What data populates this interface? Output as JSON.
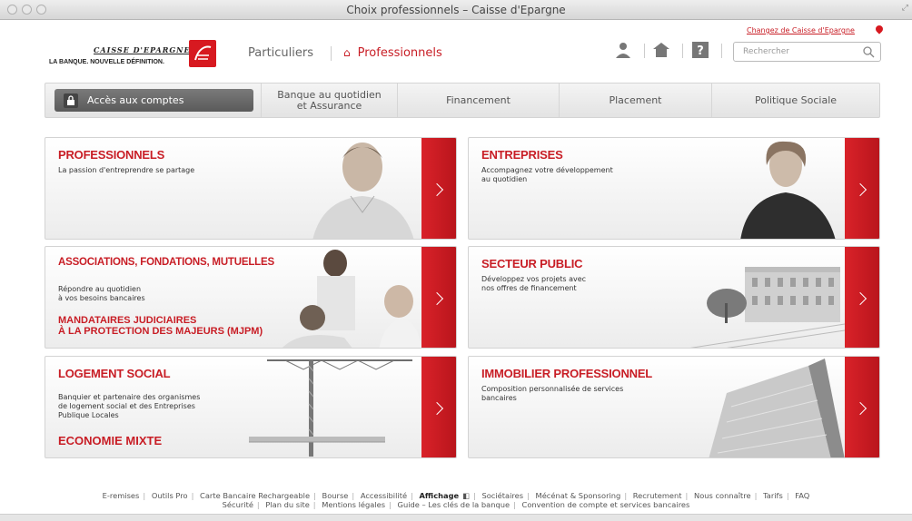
{
  "window": {
    "title": "Choix professionnels – Caisse d'Epargne"
  },
  "logo": {
    "name": "CAISSE D'EPARGNE",
    "tagline": "LA BANQUE. NOUVELLE DÉFINITION."
  },
  "nav": {
    "particuliers": "Particuliers",
    "professionnels": "Professionnels"
  },
  "header": {
    "change_link": "Changez de Caisse d'Epargne"
  },
  "search": {
    "placeholder": "Rechercher"
  },
  "menu": {
    "acces": "Accès aux comptes",
    "items": [
      "Banque au quotidien\net Assurance",
      "Financement",
      "Placement",
      "Politique Sociale"
    ]
  },
  "cards": [
    {
      "title": "PROFESSIONNELS",
      "sub": "La passion d'entreprendre se partage"
    },
    {
      "title": "ENTREPRISES",
      "sub": "Accompagnez votre développement\nau quotidien"
    },
    {
      "title": "ASSOCIATIONS, FONDATIONS, MUTUELLES",
      "sub": "Répondre au quotidien\nà vos besoins bancaires",
      "title2": "MANDATAIRES JUDICIAIRES\nÀ LA PROTECTION DES MAJEURS (MJPM)"
    },
    {
      "title": "SECTEUR PUBLIC",
      "sub": "Développez vos projets avec\nnos offres de financement"
    },
    {
      "title": "LOGEMENT SOCIAL",
      "sub": "Banquier et partenaire des organismes\nde logement social et des Entreprises\nPublique Locales",
      "title2": "ECONOMIE MIXTE"
    },
    {
      "title": "IMMOBILIER PROFESSIONNEL",
      "sub": "Composition personnalisée de services\nbancaires"
    }
  ],
  "footer": {
    "row1": [
      "E-remises",
      "Outils Pro",
      "Carte Bancaire Rechargeable",
      "Bourse",
      "Accessibilité",
      "Affichage",
      "Sociétaires",
      "Mécénat & Sponsoring",
      "Recrutement",
      "Nous connaître",
      "Tarifs",
      "FAQ"
    ],
    "row2": [
      "Sécurité",
      "Plan du site",
      "Mentions légales",
      "Guide – Les clés de la banque",
      "Convention de compte et services bancaires"
    ]
  },
  "colors": {
    "brand_red": "#c81d25",
    "menu_dark": "#5a5a5a"
  }
}
